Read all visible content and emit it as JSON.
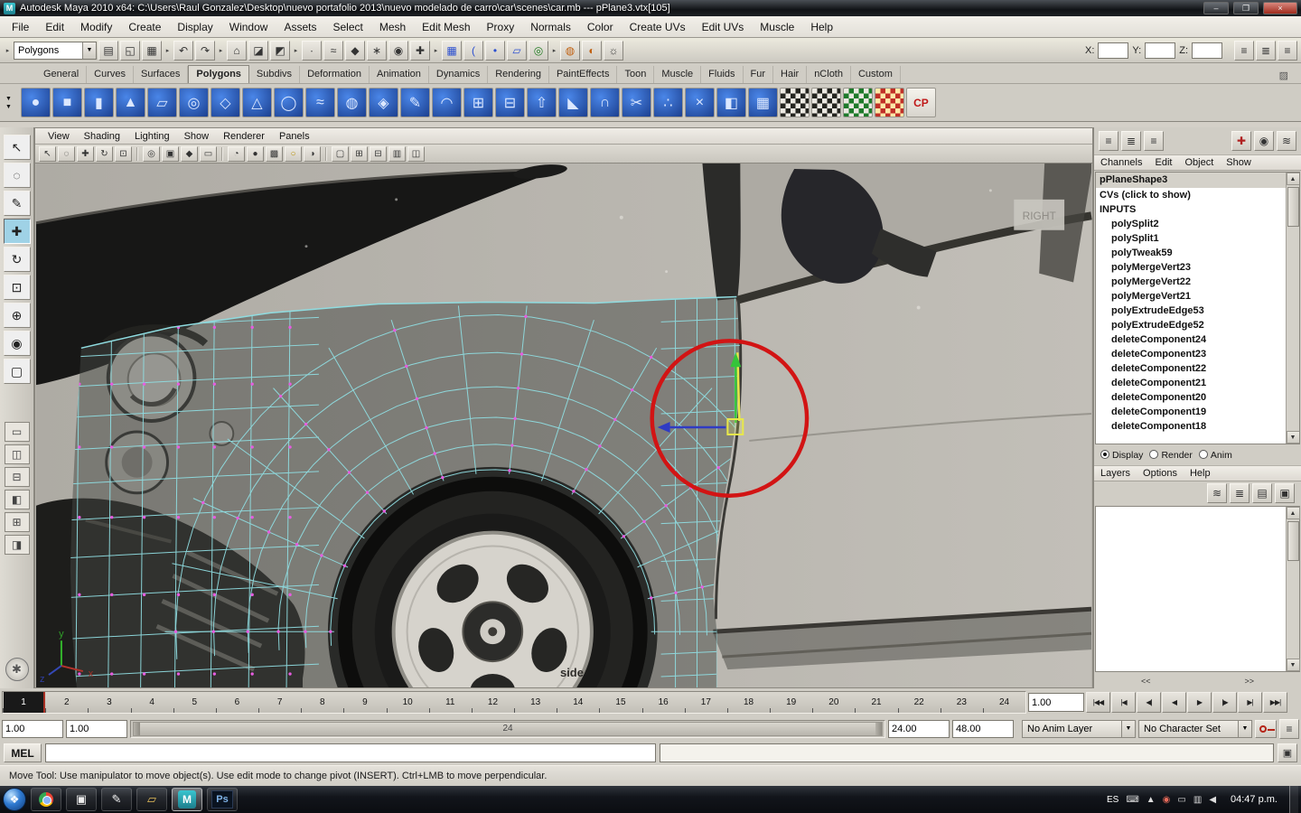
{
  "window": {
    "app_icon": "M",
    "title": "Autodesk Maya 2010 x64: C:\\Users\\Raul Gonzalez\\Desktop\\nuevo portafolio 2013\\nuevo modelado de carro\\car\\scenes\\car.mb   ---   pPlane3.vtx[105]",
    "minimize": "–",
    "maximize": "❐",
    "close": "×"
  },
  "menubar": [
    "File",
    "Edit",
    "Modify",
    "Create",
    "Display",
    "Window",
    "Assets",
    "Select",
    "Mesh",
    "Edit Mesh",
    "Proxy",
    "Normals",
    "Color",
    "Create UVs",
    "Edit UVs",
    "Muscle",
    "Help"
  ],
  "statusline": {
    "mode": "Polygons",
    "x_label": "X:",
    "y_label": "Y:",
    "z_label": "Z:",
    "x_value": "",
    "y_value": "",
    "z_value": "",
    "icons": [
      {
        "name": "file-new-icon",
        "glyph": "▤"
      },
      {
        "name": "file-open-icon",
        "glyph": "◱"
      },
      {
        "name": "file-save-icon",
        "glyph": "▦"
      },
      {
        "name": "sep"
      },
      {
        "name": "undo-icon",
        "glyph": "↶"
      },
      {
        "name": "redo-icon",
        "glyph": "↷"
      },
      {
        "name": "sep"
      },
      {
        "name": "select-hierarchy-icon",
        "glyph": "⌂"
      },
      {
        "name": "select-object-icon",
        "glyph": "◪"
      },
      {
        "name": "select-component-icon",
        "glyph": "◩"
      },
      {
        "name": "sep"
      },
      {
        "name": "mask-points-icon",
        "glyph": "∙"
      },
      {
        "name": "mask-curves-icon",
        "glyph": "≈"
      },
      {
        "name": "mask-surfaces-icon",
        "glyph": "◆"
      },
      {
        "name": "mask-deformations-icon",
        "glyph": "∗"
      },
      {
        "name": "mask-rendering-icon",
        "glyph": "◉"
      },
      {
        "name": "mask-misc-icon",
        "glyph": "✚"
      },
      {
        "name": "sep"
      },
      {
        "name": "snap-to-grid-icon",
        "glyph": "▦",
        "c": "blue"
      },
      {
        "name": "snap-to-curve-icon",
        "glyph": "(",
        "c": "blue"
      },
      {
        "name": "snap-to-point-icon",
        "glyph": "•",
        "c": "blue"
      },
      {
        "name": "snap-to-plane-icon",
        "glyph": "▱",
        "c": "blue"
      },
      {
        "name": "make-live-icon",
        "glyph": "◎",
        "c": "green"
      },
      {
        "name": "sep"
      },
      {
        "name": "render-current-frame-icon",
        "glyph": "◍",
        "c": "orange"
      },
      {
        "name": "ipr-render-icon",
        "glyph": "◐",
        "c": "orange"
      },
      {
        "name": "render-settings-icon",
        "glyph": "☼"
      }
    ],
    "right_icons": [
      {
        "name": "attribute-editor-toggle-icon",
        "glyph": "≡"
      },
      {
        "name": "tool-settings-toggle-icon",
        "glyph": "≣"
      },
      {
        "name": "channel-box-toggle-icon",
        "glyph": "≡"
      }
    ]
  },
  "shelf": {
    "tabs": [
      "General",
      "Curves",
      "Surfaces",
      "Polygons",
      "Subdivs",
      "Deformation",
      "Animation",
      "Dynamics",
      "Rendering",
      "PaintEffects",
      "Toon",
      "Muscle",
      "Fluids",
      "Fur",
      "Hair",
      "nCloth",
      "Custom"
    ],
    "active_tab": "Polygons",
    "editor_glyph": "▨",
    "icons": [
      {
        "name": "poly-sphere-icon",
        "glyph": "●"
      },
      {
        "name": "poly-cube-icon",
        "glyph": "■"
      },
      {
        "name": "poly-cylinder-icon",
        "glyph": "▮"
      },
      {
        "name": "poly-cone-icon",
        "glyph": "▲"
      },
      {
        "name": "poly-plane-icon",
        "glyph": "▱"
      },
      {
        "name": "poly-torus-icon",
        "glyph": "◎"
      },
      {
        "name": "poly-prism-icon",
        "glyph": "◇"
      },
      {
        "name": "poly-pyramid-icon",
        "glyph": "△"
      },
      {
        "name": "poly-pipe-icon",
        "glyph": "◯"
      },
      {
        "name": "poly-helix-icon",
        "glyph": "≈"
      },
      {
        "name": "poly-soccerball-icon",
        "glyph": "◍"
      },
      {
        "name": "poly-platonic-icon",
        "glyph": "◈"
      },
      {
        "name": "sculpt-geometry-icon",
        "glyph": "✎"
      },
      {
        "name": "smooth-icon",
        "glyph": "◠"
      },
      {
        "name": "combine-icon",
        "glyph": "⊞"
      },
      {
        "name": "separate-icon",
        "glyph": "⊟"
      },
      {
        "name": "extrude-icon",
        "glyph": "⇧"
      },
      {
        "name": "bevel-icon",
        "glyph": "◣"
      },
      {
        "name": "bridge-icon",
        "glyph": "∩"
      },
      {
        "name": "split-polygon-icon",
        "glyph": "✂"
      },
      {
        "name": "merge-vertices-icon",
        "glyph": "∴"
      },
      {
        "name": "delete-edge-icon",
        "glyph": "×"
      },
      {
        "name": "mirror-geometry-icon",
        "glyph": "◧"
      },
      {
        "name": "quad-draw-icon",
        "glyph": "▦"
      },
      {
        "name": "uv-checker-icon",
        "tile": "checker",
        "glyph": ""
      },
      {
        "name": "uv-checker-2-icon",
        "tile": "checker",
        "glyph": ""
      },
      {
        "name": "uv-checker-green-icon",
        "tile": "checker-green",
        "glyph": ""
      },
      {
        "name": "uv-texture-editor-icon",
        "tile": "checker-color",
        "glyph": ""
      },
      {
        "name": "cp-export-icon",
        "tile": "cp",
        "glyph": "CP"
      }
    ]
  },
  "toolbox": {
    "tools": [
      {
        "name": "select-tool",
        "glyph": "↖"
      },
      {
        "name": "lasso-select-tool",
        "glyph": "◌"
      },
      {
        "name": "paint-select-tool",
        "glyph": "✎"
      },
      {
        "name": "move-tool",
        "glyph": "✚",
        "active": true
      },
      {
        "name": "rotate-tool",
        "glyph": "↻"
      },
      {
        "name": "scale-tool",
        "glyph": "⊡"
      },
      {
        "name": "universal-manipulator-tool",
        "glyph": "⊕"
      },
      {
        "name": "soft-modification-tool",
        "glyph": "◉"
      },
      {
        "name": "last-tool-slot",
        "glyph": "▢"
      }
    ],
    "layouts": [
      {
        "name": "single-pane-layout-button",
        "glyph": "▭"
      },
      {
        "name": "two-pane-side-layout-button",
        "glyph": "◫"
      },
      {
        "name": "two-pane-stacked-layout-button",
        "glyph": "⊟"
      },
      {
        "name": "three-pane-layout-button",
        "glyph": "◧"
      },
      {
        "name": "four-pane-layout-button",
        "glyph": "⊞"
      },
      {
        "name": "outliner-persp-layout-button",
        "glyph": "◨"
      }
    ],
    "quick_help_glyph": "✱"
  },
  "panel": {
    "menus": [
      "View",
      "Shading",
      "Lighting",
      "Show",
      "Renderer",
      "Panels"
    ],
    "toolbar_icons": [
      {
        "name": "panel-select-icon",
        "glyph": "↖"
      },
      {
        "name": "panel-lasso-icon",
        "glyph": "◌"
      },
      {
        "name": "panel-move-icon",
        "glyph": "✚"
      },
      {
        "name": "panel-rotate-icon",
        "glyph": "↻"
      },
      {
        "name": "panel-scale-icon",
        "glyph": "⊡"
      },
      {
        "name": "sep"
      },
      {
        "name": "camera-select-icon",
        "glyph": "◎"
      },
      {
        "name": "camera-attributes-icon",
        "glyph": "▣"
      },
      {
        "name": "bookmark-icon",
        "glyph": "◆"
      },
      {
        "name": "image-plane-icon",
        "glyph": "▭"
      },
      {
        "name": "sep"
      },
      {
        "name": "wireframe-display-icon",
        "glyph": "◔"
      },
      {
        "name": "shaded-display-icon",
        "glyph": "●"
      },
      {
        "name": "textured-display-icon",
        "glyph": "▩"
      },
      {
        "name": "lights-display-icon",
        "glyph": "○",
        "c": "yellow"
      },
      {
        "name": "shadows-display-icon",
        "glyph": "◑"
      },
      {
        "name": "sep"
      },
      {
        "name": "isolate-select-icon",
        "glyph": "▢"
      },
      {
        "name": "field-chart-icon",
        "glyph": "⊞"
      },
      {
        "name": "gate-mask-icon",
        "glyph": "⊟"
      },
      {
        "name": "safe-display-icon",
        "glyph": "▥"
      },
      {
        "name": "xray-display-icon",
        "glyph": "◫"
      }
    ]
  },
  "viewport": {
    "view_label": "RIGHT",
    "image_plane_label": "side",
    "axis_x": "x",
    "axis_y": "y",
    "axis_z": "z"
  },
  "channel_box": {
    "menus": [
      "Channels",
      "Edit",
      "Object",
      "Show"
    ],
    "top_icons_left": [
      {
        "name": "channel-sort-icon",
        "glyph": "≡"
      },
      {
        "name": "channel-group-icon",
        "glyph": "≣"
      },
      {
        "name": "channel-filter-icon",
        "glyph": "≡"
      }
    ],
    "top_icons_right": [
      {
        "name": "channel-speed-icon",
        "glyph": "✚",
        "c": "red"
      },
      {
        "name": "channel-hyperbolic-icon",
        "glyph": "◉"
      },
      {
        "name": "channel-settings-icon",
        "glyph": "≋"
      }
    ],
    "shape_name": "pPlaneShape3",
    "cvs_label": "CVs (click to show)",
    "inputs_label": "INPUTS",
    "inputs": [
      "polySplit2",
      "polySplit1",
      "polyTweak59",
      "polyMergeVert23",
      "polyMergeVert22",
      "polyMergeVert21",
      "polyExtrudeEdge53",
      "polyExtrudeEdge52",
      "deleteComponent24",
      "deleteComponent23",
      "deleteComponent22",
      "deleteComponent21",
      "deleteComponent20",
      "deleteComponent19",
      "deleteComponent18"
    ]
  },
  "display_modes": {
    "options": [
      "Display",
      "Render",
      "Anim"
    ],
    "selected": "Display"
  },
  "layer_editor": {
    "menus": [
      "Layers",
      "Options",
      "Help"
    ],
    "icons": [
      {
        "name": "layer-sort-icon",
        "glyph": "≋"
      },
      {
        "name": "layer-options-icon",
        "glyph": "≣"
      },
      {
        "name": "create-empty-layer-icon",
        "glyph": "▤"
      },
      {
        "name": "create-layer-from-selected-icon",
        "glyph": "▣"
      }
    ],
    "pane_left": "<<",
    "pane_right": ">>"
  },
  "timeline": {
    "frames": [
      1,
      2,
      3,
      4,
      5,
      6,
      7,
      8,
      9,
      10,
      11,
      12,
      13,
      14,
      15,
      16,
      17,
      18,
      19,
      20,
      21,
      22,
      23,
      24
    ],
    "current_frame": "1",
    "current_time": "1.00",
    "playback": [
      {
        "name": "go-to-start-button",
        "glyph": "|◀◀"
      },
      {
        "name": "step-back-frame-button",
        "glyph": "|◀"
      },
      {
        "name": "step-back-key-button",
        "glyph": "◀|"
      },
      {
        "name": "play-backwards-button",
        "glyph": "◀"
      },
      {
        "name": "play-forwards-button",
        "glyph": "▶"
      },
      {
        "name": "step-forward-key-button",
        "glyph": "|▶"
      },
      {
        "name": "step-forward-frame-button",
        "glyph": "▶|"
      },
      {
        "name": "go-to-end-button",
        "glyph": "▶▶|"
      }
    ]
  },
  "range_slider": {
    "anim_start": "1.00",
    "playback_start": "1.00",
    "range_label": "24",
    "playback_end": "24.00",
    "anim_end": "48.00",
    "anim_layer": "No Anim Layer",
    "character_set": "No Character Set",
    "prefs_glyph": "≡"
  },
  "command_line": {
    "label": "MEL",
    "input_value": "",
    "result_value": "",
    "script_editor_glyph": "▣"
  },
  "help_line": {
    "text": "Move Tool: Use manipulator to move object(s). Use edit mode to change pivot (INSERT).  Ctrl+LMB to move perpendicular."
  },
  "taskbar": {
    "start_glyph": "❖",
    "apps": [
      {
        "name": "taskbar-chrome-icon",
        "kind": "chrome"
      },
      {
        "name": "taskbar-app-icon",
        "glyph": "▣"
      },
      {
        "name": "taskbar-paint-icon",
        "glyph": "✎"
      },
      {
        "name": "taskbar-folder-icon",
        "glyph": "▱",
        "color": "#e8c15a"
      },
      {
        "name": "taskbar-maya-icon",
        "kind": "maya",
        "glyph": "M",
        "active": true
      },
      {
        "name": "taskbar-photoshop-icon",
        "kind": "ps",
        "glyph": "Ps"
      }
    ],
    "language": "ES",
    "tray": [
      {
        "name": "tray-keyboard-icon",
        "glyph": "⌨"
      },
      {
        "name": "tray-expand-icon",
        "glyph": "▲"
      },
      {
        "name": "tray-update-icon",
        "glyph": "◉",
        "color": "#e66a5a"
      },
      {
        "name": "tray-display-icon",
        "glyph": "▭"
      },
      {
        "name": "tray-network-icon",
        "glyph": "▥"
      },
      {
        "name": "tray-volume-icon",
        "glyph": "◀"
      }
    ],
    "time": "04:47 p.m."
  }
}
